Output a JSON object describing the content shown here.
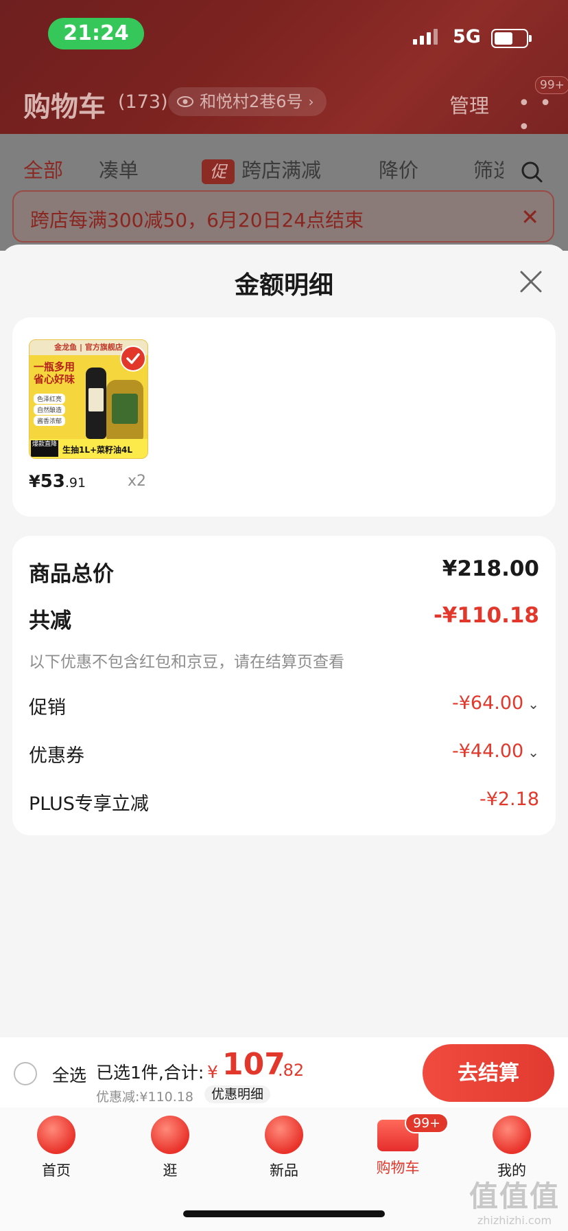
{
  "status": {
    "time": "21:24",
    "network": "5G"
  },
  "header": {
    "title": "购物车",
    "count": "(173)",
    "address": "和悦村2巷6号",
    "manage": "管理",
    "more_badge": "99+"
  },
  "filters": {
    "tabs": [
      "全部",
      "凑单",
      "跨店满减",
      "降价",
      "筛选"
    ],
    "promo_tag": "促",
    "banner": "跨店每满300减50，6月20日24点结束"
  },
  "sheet": {
    "title": "金额明细",
    "product": {
      "image_brand": "金龙鱼 | 官方旗舰店",
      "image_slogan": "一瓶多用省心好味",
      "image_chips": [
        "色泽红亮",
        "自然酿造",
        "酱香浓郁"
      ],
      "image_hot": "爆款直降",
      "image_combo": "生抽1L+菜籽油4L",
      "price_yen": "¥",
      "price_int": "53",
      "price_dec": ".91",
      "qty": "x2"
    },
    "amount": {
      "total_label": "商品总价",
      "total_value": "¥218.00",
      "reduce_label": "共减",
      "reduce_value": "-¥110.18",
      "note": "以下优惠不包含红包和京豆，请在结算页查看",
      "items": [
        {
          "label": "促销",
          "value": "-¥64.00",
          "expandable": true
        },
        {
          "label": "优惠券",
          "value": "-¥44.00",
          "expandable": true
        },
        {
          "label": "PLUS专享立减",
          "value": "-¥2.18",
          "expandable": false
        }
      ]
    }
  },
  "checkout": {
    "select_all": "全选",
    "selected_text": "已选1件,合计:",
    "total_yen": "¥",
    "total_int": "107",
    "total_dec": ".82",
    "discount_line": "优惠减:¥110.18",
    "discount_detail": "优惠明细",
    "button": "去结算"
  },
  "tabbar": {
    "items": [
      "首页",
      "逛",
      "新品",
      "购物车",
      "我的"
    ],
    "active_index": 3,
    "cart_badge": "99+"
  },
  "watermark": {
    "big": "值值值",
    "small": "zhizhizhi.com"
  },
  "colors": {
    "accent": "#e2382c",
    "status_green": "#35c759"
  }
}
